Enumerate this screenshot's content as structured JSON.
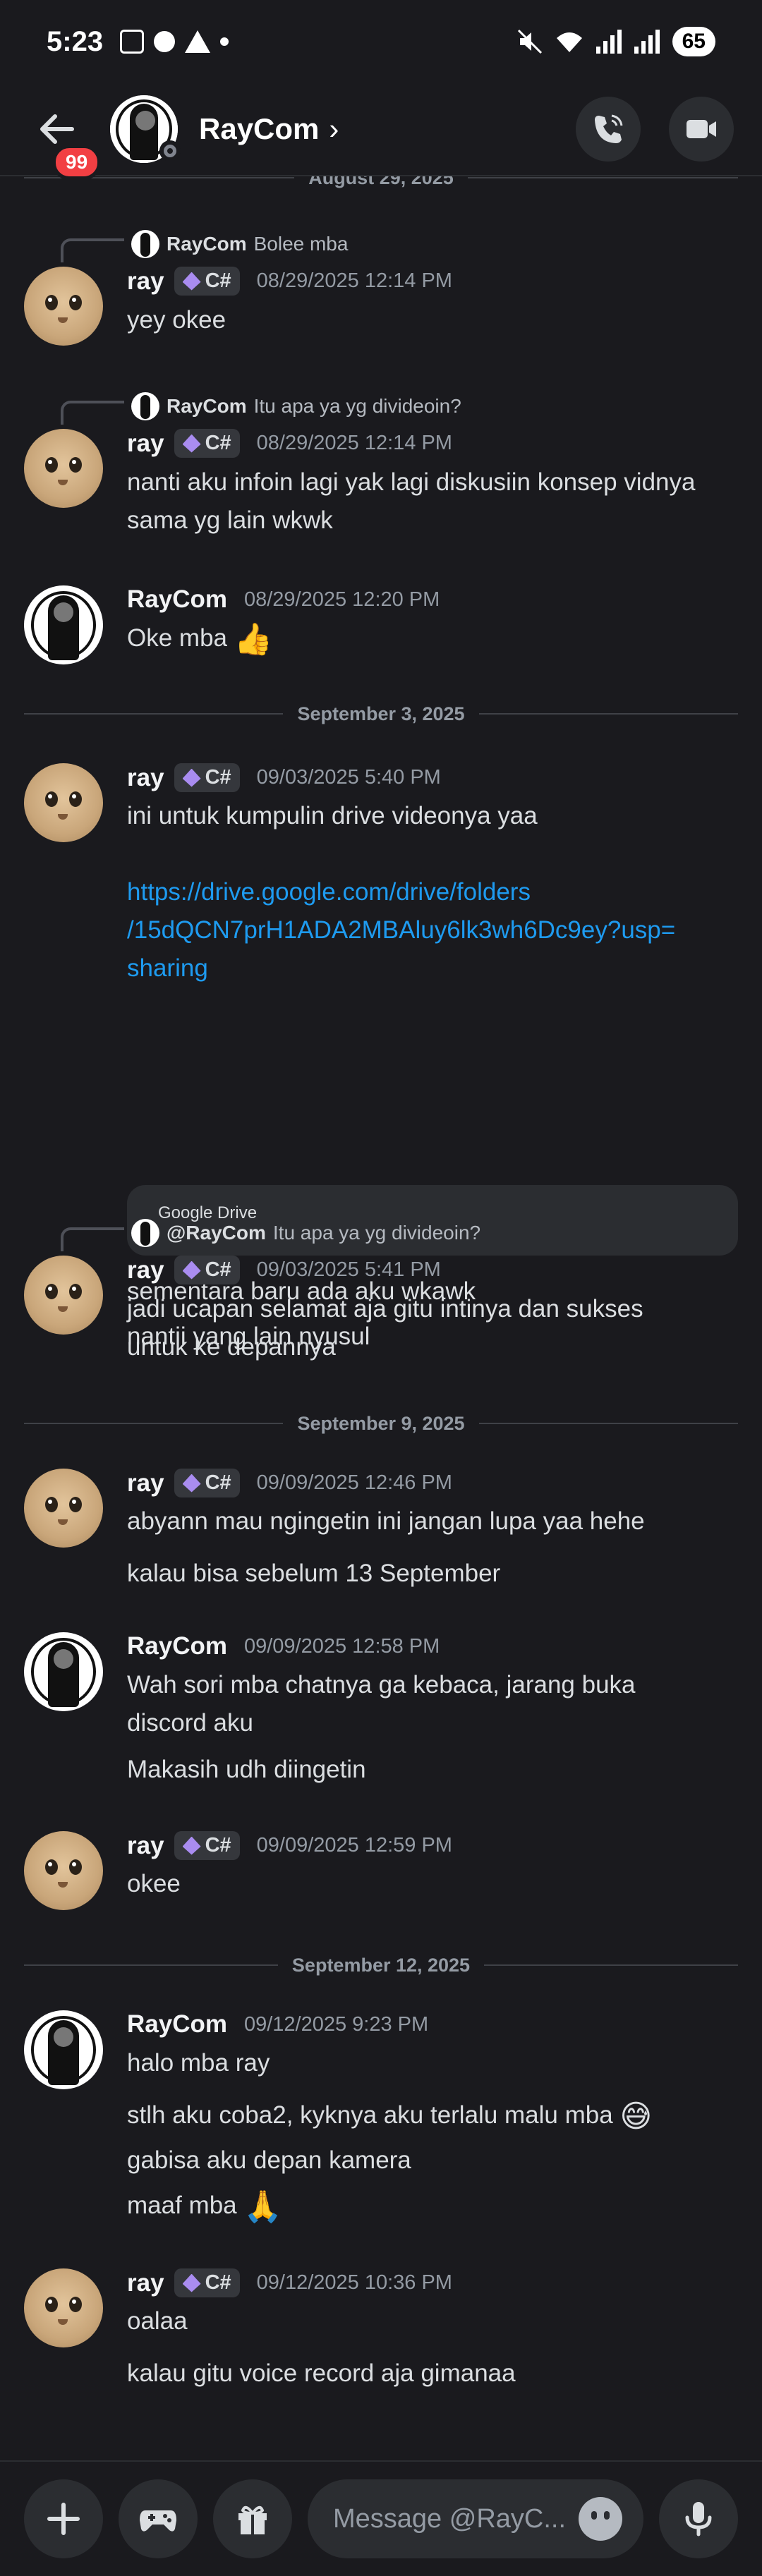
{
  "status": {
    "time": "5:23",
    "battery": "65"
  },
  "header": {
    "unread_badge": "99",
    "name": "RayCom",
    "chevron": "›"
  },
  "dividers": {
    "d0": "August 29, 2025",
    "d1": "September 3, 2025",
    "d2": "September 9, 2025",
    "d3": "September 12, 2025"
  },
  "role_tag": "C#",
  "messages": {
    "m1": {
      "reply_name": "RayCom",
      "reply_text": "Bolee mba",
      "author": "ray",
      "time": "08/29/2025 12:14 PM",
      "text": "yey okee"
    },
    "m2": {
      "reply_name": "RayCom",
      "reply_text": "Itu apa ya yg divideoin?",
      "author": "ray",
      "time": "08/29/2025 12:14 PM",
      "line1": "nanti aku infoin lagi yak lagi diskusiin konsep vidnya",
      "line2": "sama yg lain wkwk"
    },
    "m3": {
      "author": "RayCom",
      "time": "08/29/2025 12:20 PM",
      "text": "Oke mba",
      "emoji": "👍"
    },
    "m4": {
      "author": "ray",
      "time": "09/03/2025 5:40 PM",
      "text": "ini untuk kumpulin drive videonya yaa",
      "link1": "https://drive.google.com/drive/folders",
      "link2": "/15dQCN7prH1ADA2MBAluy6lk3wh6Dc9ey?usp=",
      "link3": "sharing",
      "embed_title": "Google Drive",
      "text2": "sementara baru ada aku wkawk",
      "text3": "nantii yang lain nyusul"
    },
    "m5": {
      "reply_name": "@RayCom",
      "reply_text": "Itu apa ya yg divideoin?",
      "author": "ray",
      "time": "09/03/2025 5:41 PM",
      "line1": "jadi ucapan selamat aja gitu intinya dan sukses",
      "line2": "untuk ke depannya"
    },
    "m6": {
      "author": "ray",
      "time": "09/09/2025 12:46 PM",
      "text": "abyann mau ngingetin ini jangan lupa  yaa hehe",
      "text2": "kalau bisa sebelum 13 September"
    },
    "m7": {
      "author": "RayCom",
      "time": "09/09/2025 12:58 PM",
      "line1": "Wah sori mba chatnya ga kebaca, jarang buka",
      "line2": "discord aku",
      "text2": "Makasih udh diingetin"
    },
    "m8": {
      "author": "ray",
      "time": "09/09/2025 12:59 PM",
      "text": "okee"
    },
    "m9": {
      "author": "RayCom",
      "time": "09/12/2025 9:23 PM",
      "text": "halo mba ray",
      "text2": "stlh aku coba2, kyknya aku terlalu malu mba",
      "emoji2": "😅",
      "text3": "gabisa aku depan kamera",
      "text4": "maaf mba",
      "emoji4": "🙏"
    },
    "m10": {
      "author": "ray",
      "time": "09/12/2025 10:36 PM",
      "text": "oalaa",
      "text2": "kalau gitu voice record aja gimanaa"
    }
  },
  "composer": {
    "placeholder": "Message @RayC..."
  },
  "colors": {
    "background": "#1a1a1e",
    "link": "#1e9bf0",
    "badge": "#f23f43"
  }
}
